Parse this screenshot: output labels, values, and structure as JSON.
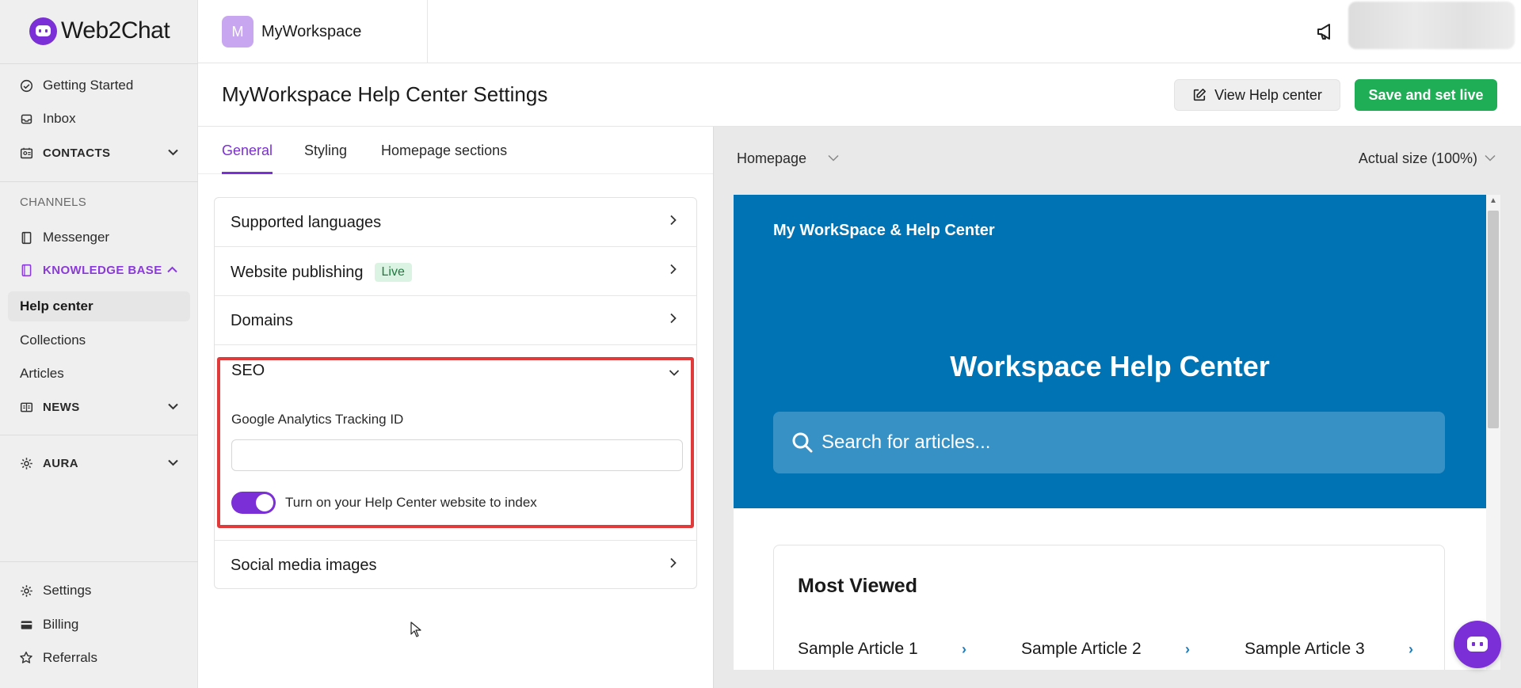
{
  "app": {
    "name": "Web2Chat"
  },
  "workspace": {
    "initial": "M",
    "name": "MyWorkspace"
  },
  "sidebar": {
    "items": [
      {
        "label": "Getting Started",
        "icon": "check-circle-icon"
      },
      {
        "label": "Inbox",
        "icon": "inbox-icon"
      },
      {
        "label": "CONTACTS",
        "icon": "contacts-icon"
      },
      {
        "label": "CHANNELS"
      },
      {
        "label": "Messenger",
        "icon": "messenger-icon"
      },
      {
        "label": "KNOWLEDGE BASE",
        "icon": "book-icon"
      },
      {
        "label": "Help center"
      },
      {
        "label": "Collections"
      },
      {
        "label": "Articles"
      },
      {
        "label": "NEWS",
        "icon": "news-icon"
      },
      {
        "label": "AURA",
        "icon": "gear-icon"
      }
    ],
    "footer": [
      {
        "label": "Settings",
        "icon": "gear-icon"
      },
      {
        "label": "Billing",
        "icon": "credit-card-icon"
      },
      {
        "label": "Referrals",
        "icon": "star-icon"
      }
    ]
  },
  "header": {
    "title": "MyWorkspace Help Center Settings",
    "view_button": "View Help center",
    "save_button": "Save and set live"
  },
  "settings": {
    "tabs": [
      "General",
      "Styling",
      "Homepage sections"
    ],
    "sections": {
      "languages": "Supported languages",
      "publishing": "Website publishing",
      "publishing_badge": "Live",
      "domains": "Domains",
      "seo": "SEO",
      "social": "Social media images"
    },
    "seo": {
      "ga_label": "Google Analytics Tracking ID",
      "ga_value": "",
      "index_toggle_label": "Turn on your Help Center website to index",
      "index_toggle_on": true
    }
  },
  "preview": {
    "page_select": "Homepage",
    "zoom_select": "Actual size (100%)",
    "brand": "My WorkSpace & Help Center",
    "hero_title": "Workspace Help Center",
    "search_placeholder": "Search for articles...",
    "section_title": "Most Viewed",
    "articles": [
      "Sample Article 1",
      "Sample Article 2",
      "Sample Article 3"
    ],
    "colors": {
      "hero": "#0073b4",
      "accent": "#7b2fd6",
      "save": "#1fae55",
      "highlight": "#e03a3a"
    }
  }
}
